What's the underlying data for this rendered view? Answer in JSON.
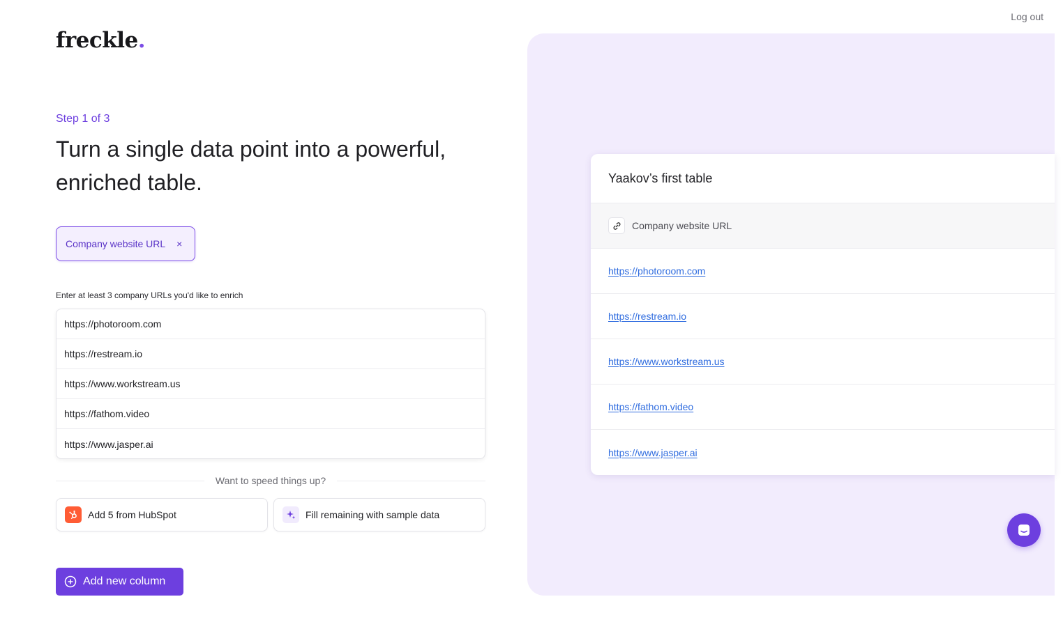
{
  "header": {
    "logout_label": "Log out"
  },
  "logo": {
    "text": "freckle",
    "dot": "."
  },
  "left": {
    "step": "Step 1 of 3",
    "headline": "Turn a single data point into a powerful, enriched table.",
    "chip": {
      "label": "Company website URL",
      "remove_symbol": "×"
    },
    "hint": "Enter at least 3 company URLs you'd like to enrich",
    "urls": [
      "https://photoroom.com",
      "https://restream.io",
      "https://www.workstream.us",
      "https://fathom.video",
      "https://www.jasper.ai"
    ],
    "divider_text": "Want to speed things up?",
    "hubspot_label": "Add 5 from HubSpot",
    "sample_label": "Fill remaining with sample data",
    "add_column_label": "Add new column"
  },
  "preview": {
    "title": "Yaakov’s first table",
    "column_header": "Company website URL",
    "rows": [
      "https://photoroom.com",
      "https://restream.io",
      "https://www.workstream.us",
      "https://fathom.video",
      "https://www.jasper.ai"
    ]
  },
  "colors": {
    "accent": "#6d3fdf",
    "panel_bg": "#f2ecfd",
    "link": "#2f6cdf",
    "hubspot": "#ff5c35"
  },
  "icons": [
    "x-icon",
    "hubspot-icon",
    "sparkle-icon",
    "plus-circle-icon",
    "link-icon",
    "chat-icon"
  ]
}
